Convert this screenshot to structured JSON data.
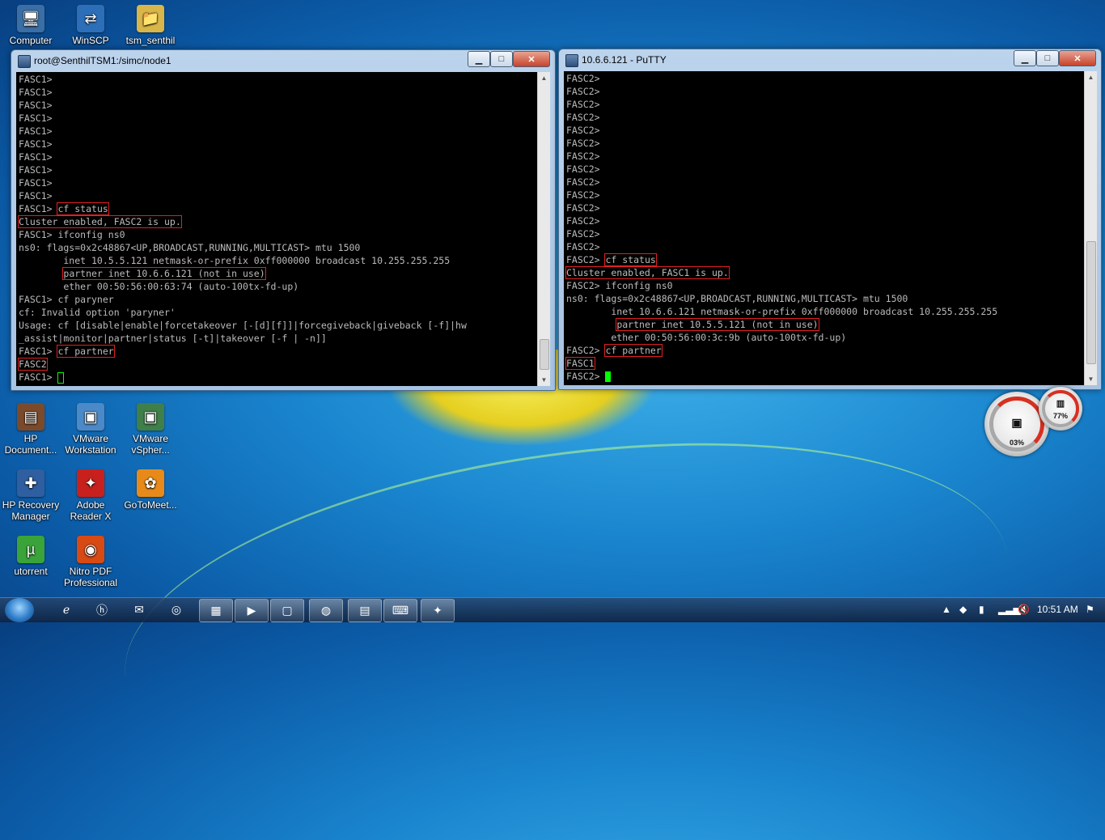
{
  "desktop_icons": [
    {
      "label": "Computer",
      "icon": "computer-icon",
      "glyph": "🖥",
      "color": "#3a6ea5"
    },
    {
      "label": "WinSCP",
      "icon": "winscp-icon",
      "glyph": "⇄",
      "color": "#2c6fb8"
    },
    {
      "label": "tsm_senthil",
      "icon": "folder-icon",
      "glyph": "📁",
      "color": "#d8b64a"
    },
    {
      "label": "HP Document...",
      "icon": "hp-document-icon",
      "glyph": "▤",
      "color": "#7a4a2a"
    },
    {
      "label": "VMware Workstation",
      "icon": "vmware-workstation-icon",
      "glyph": "▣",
      "color": "#4b89c8"
    },
    {
      "label": "VMware vSpher...",
      "icon": "vmware-vsphere-icon",
      "glyph": "▣",
      "color": "#3f7f4a"
    },
    {
      "label": "HP Recovery Manager",
      "icon": "hp-recovery-icon",
      "glyph": "✚",
      "color": "#2f5fa0"
    },
    {
      "label": "Adobe Reader X",
      "icon": "adobe-reader-icon",
      "glyph": "✦",
      "color": "#c8201c"
    },
    {
      "label": "GoToMeet...",
      "icon": "gotomeeting-icon",
      "glyph": "✿",
      "color": "#e88a1a"
    },
    {
      "label": "utorrent",
      "icon": "utorrent-icon",
      "glyph": "µ",
      "color": "#3aa33a"
    },
    {
      "label": "Nitro PDF Professional",
      "icon": "nitro-pdf-icon",
      "glyph": "◉",
      "color": "#d84a14"
    }
  ],
  "left_window": {
    "title": "root@SenthilTSM1:/simc/node1",
    "controls": {
      "minimize": "▁",
      "maximize": "□",
      "close": "✕"
    },
    "lines": [
      {
        "t": "FASC1>"
      },
      {
        "t": "FASC1>"
      },
      {
        "t": "FASC1>"
      },
      {
        "t": "FASC1>"
      },
      {
        "t": "FASC1>"
      },
      {
        "t": "FASC1>"
      },
      {
        "t": "FASC1>"
      },
      {
        "t": "FASC1>"
      },
      {
        "t": "FASC1>"
      },
      {
        "t": "FASC1>"
      },
      {
        "t": "FASC1>",
        "h": "cf status"
      },
      {
        "h": "Cluster enabled, FASC2 is up."
      },
      {
        "t": "FASC1> ifconfig ns0"
      },
      {
        "t": "ns0: flags=0x2c48867<UP,BROADCAST,RUNNING,MULTICAST> mtu 1500"
      },
      {
        "t": "        inet 10.5.5.121 netmask-or-prefix 0xff000000 broadcast 10.255.255.255"
      },
      {
        "t": "       ",
        "h": "partner inet 10.6.6.121 (not in use)"
      },
      {
        "t": "        ether 00:50:56:00:63:74 (auto-100tx-fd-up)"
      },
      {
        "t": "FASC1> cf paryner"
      },
      {
        "t": "cf: Invalid option 'paryner'"
      },
      {
        "t": "Usage: cf [disable|enable|forcetakeover [-[d][f]]|forcegiveback|giveback [-f]|hw"
      },
      {
        "t": "_assist|monitor|partner|status [-t]|takeover [-f | -n]]"
      },
      {
        "t": "FASC1>",
        "h": "cf partner"
      },
      {
        "h": "FASC2"
      },
      {
        "t": "FASC1> ",
        "cursor": "hollow"
      }
    ]
  },
  "right_window": {
    "title": "10.6.6.121 - PuTTY",
    "controls": {
      "minimize": "▁",
      "maximize": "□",
      "close": "✕"
    },
    "lines": [
      {
        "t": "FASC2>"
      },
      {
        "t": "FASC2>"
      },
      {
        "t": "FASC2>"
      },
      {
        "t": "FASC2>"
      },
      {
        "t": "FASC2>"
      },
      {
        "t": "FASC2>"
      },
      {
        "t": "FASC2>"
      },
      {
        "t": "FASC2>"
      },
      {
        "t": "FASC2>"
      },
      {
        "t": "FASC2>"
      },
      {
        "t": "FASC2>"
      },
      {
        "t": "FASC2>"
      },
      {
        "t": "FASC2>"
      },
      {
        "t": "FASC2>"
      },
      {
        "t": "FASC2>",
        "h": "cf status"
      },
      {
        "h": "Cluster enabled, FASC1 is up."
      },
      {
        "t": "FASC2> ifconfig ns0"
      },
      {
        "t": "ns0: flags=0x2c48867<UP,BROADCAST,RUNNING,MULTICAST> mtu 1500"
      },
      {
        "t": "        inet 10.6.6.121 netmask-or-prefix 0xff000000 broadcast 10.255.255.255"
      },
      {
        "t": "        ",
        "h": "partner inet 10.5.5.121 (not in use)"
      },
      {
        "t": "        ether 00:50:56:00:3c:9b (auto-100tx-fd-up)"
      },
      {
        "t": "FASC2>",
        "h": "cf partner"
      },
      {
        "h": "FASC1"
      },
      {
        "t": "FASC2> ",
        "cursor": "solid"
      }
    ]
  },
  "gadgets": {
    "cpu_label": "03%",
    "memory_label": "77%"
  },
  "taskbar": {
    "items": [
      {
        "icon": "internet-explorer-icon",
        "glyph": "ℯ",
        "open": false
      },
      {
        "icon": "hp-icon",
        "glyph": "ⓗ",
        "open": false
      },
      {
        "icon": "mail-icon",
        "glyph": "✉",
        "open": false
      },
      {
        "icon": "media-center-icon",
        "glyph": "◎",
        "open": false
      },
      {
        "icon": "explorer-icon",
        "glyph": "▦",
        "open": true
      },
      {
        "icon": "media-player-icon",
        "glyph": "▶",
        "open": true
      },
      {
        "icon": "folder-taskbar-icon",
        "glyph": "▢",
        "open": true
      },
      {
        "icon": "chrome-icon",
        "glyph": "◍",
        "open": true
      },
      {
        "icon": "notepad-icon",
        "glyph": "▤",
        "open": true
      },
      {
        "icon": "putty-icon",
        "glyph": "⌨",
        "open": true
      },
      {
        "icon": "adobe-taskbar-icon",
        "glyph": "✦",
        "open": true
      }
    ],
    "tray": [
      {
        "icon": "tray-arrow-icon",
        "glyph": "▲"
      },
      {
        "icon": "tray-network-tool-icon",
        "glyph": "◆"
      },
      {
        "icon": "battery-icon",
        "glyph": "▮"
      },
      {
        "icon": "signal-icon",
        "glyph": "▂▃▅"
      },
      {
        "icon": "volume-muted-icon",
        "glyph": "🔇"
      },
      {
        "icon": "action-center-flag-icon",
        "glyph": "⚑"
      }
    ],
    "clock": "10:51 AM"
  },
  "colors": {
    "terminal_bg": "#000000",
    "terminal_fg": "#bbbbbb",
    "highlight": "#e02020",
    "cursor": "#00ff00"
  }
}
